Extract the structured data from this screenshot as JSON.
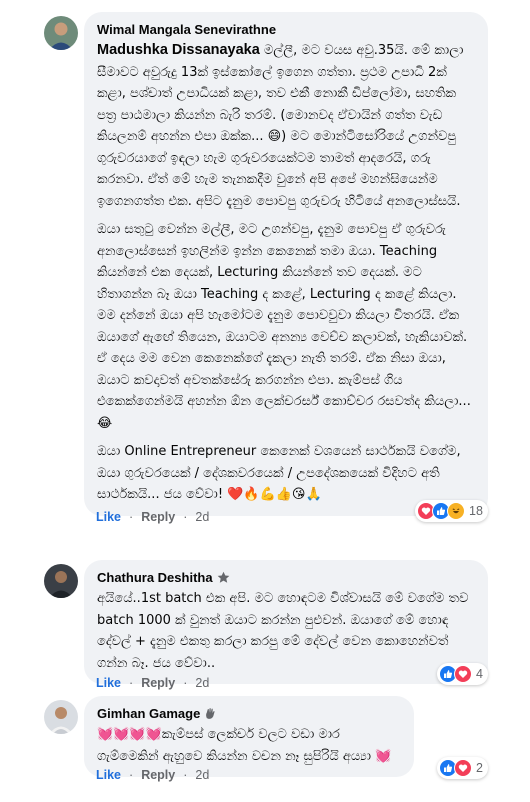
{
  "comments": [
    {
      "author": "Wimal Mangala Senevirathne",
      "mention": "Madushka Dissanayaka",
      "paragraphs": [
        "මල්ලී, මට වයස අවු.35යි. මේ කාලා සීමාවට අවුරුදු 13ක් ඉස්කෝලේ ඉගෙන ගත්තා. ප්‍රථම උපාධි 2ක් කළා, පශ්චාත් උපාධියක් කළා, තව එකී නොකී ඩිප්ලෝමා, සහතික පත්‍ර පාඨමාලා කියන්න බැරි තරම්. (මොනවද ඒවායින් ගත්ත වැඩ කියලනම් අහන්න එපා ඔක්ක... 😄) මට මොන්ටිසෝරියේ උගන්වපු ගුරුවරයාගේ ඉඳලා හැම ගුරුවරයෙක්ටම තාමත් ආදරෙයි, ගරු කරනවා. ඒත් මේ හැම තැනකදීම වුනේ අපි අපේ මහන්සියෙන්ම ඉගෙනගත්ත එක. අපිට දැනුම පොවපු ගුරුවරු හිටියේ අනලොස්සයි.",
        "ඔයා සතුටු වෙන්න මල්ලී, මට උගන්වපු, දැනුම පොවපු ඒ ගුරුවරු අනලොස්සෙන් ඉහලින්ම ඉන්න කෙනෙක් තමා ඔයා. Teaching කියන්නේ එක දෙයක්, Lecturing කියන්නේ තව දෙයක්. මට හිතාගන්න බෑ ඔයා Teaching ද කළේ, Lecturing ද කළේ කියලා. මම දන්නේ ඔයා අපි හැමෝටම දැනුම පොවවුවා කියලා විතරයි. ඒක ඔයාගේ ඇඟේ තියෙන, ඔයාටම අනන්‍ය වෙච්ච කලාවක්, හැකියාවක්. ඒ දෙය මම වෙන කෙනෙක්ගේ දැකලා නැති තරම්. ඒක නිසා ඔයා, ඔයාට කවදාවත් අවතක්සේරු කරගන්න එපා. කැම්පස් ගිය එකෙක්ගෙන්මයි අහන්න ඕන ලෙක්චරර්ස් කොච්චර රසවත්ද කියලා...😂",
        "ඔයා Online Entrepreneur කෙනෙක් වශයෙන් සාර්ථකයි වගේම, ඔයා ගුරුවරයෙක් / දේශකවරයෙක් / උපදේශකයෙක් විදිහට අති සාර්ථකයි... ජය වේවා! ❤️🔥💪👍😘🙏"
      ],
      "actions": {
        "like": "Like",
        "reply": "Reply",
        "time": "2d"
      },
      "reaction_count": "18",
      "reactions": [
        "love",
        "like",
        "haha"
      ]
    },
    {
      "author": "Chathura Deshitha",
      "paragraphs": [
        "අයියේ..1st batch එක අපි. මට හොඳටම විශ්වාසයි මේ වගේම තව batch 1000 ක් වුනත් ඔයාට කරන්න පුළුවන්. ඔයාගේ මේ හොඳ දේවල් + දැනුම එකතු කරලා කරපු මේ දේවල් වෙන කොහෙන්වත් ගන්න බෑ. ජය වේවා.."
      ],
      "actions": {
        "like": "Like",
        "reply": "Reply",
        "time": "2d"
      },
      "reaction_count": "4",
      "reactions": [
        "like",
        "love"
      ]
    },
    {
      "author": "Gimhan Gamage",
      "paragraphs": [
        "💓💓💓💓කැම්පස් ලෙක්චර් වලට වඩා මාර ගැම්මෙකින් ඇහුවෙ කියන්න වචන නෑ සුපිරියි අය්‍යා 💓"
      ],
      "actions": {
        "like": "Like",
        "reply": "Reply",
        "time": "2d"
      },
      "reaction_count": "2",
      "reactions": [
        "like",
        "love"
      ]
    }
  ],
  "colors": {
    "bubble": "#f0f2f5",
    "like_blue": "#216fdb",
    "meta_gray": "#65676b",
    "love_red": "#f33e58",
    "haha_yellow": "#f7b125"
  },
  "icons": {
    "top_fan_badge": "star-badge-icon",
    "wave_badge": "waving-hand-icon"
  }
}
